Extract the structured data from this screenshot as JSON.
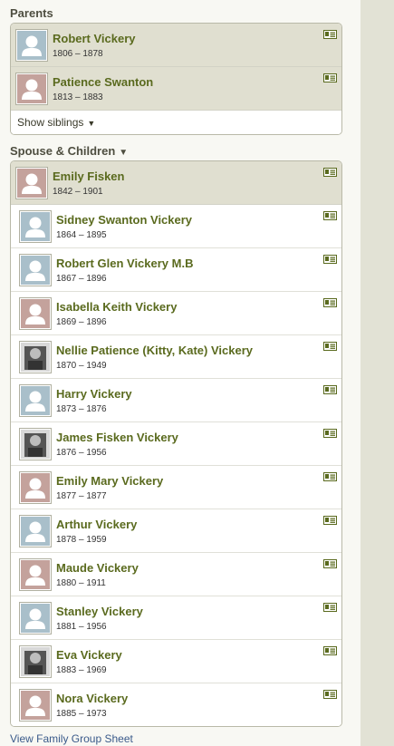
{
  "parents": {
    "title": "Parents",
    "people": [
      {
        "name": "Robert Vickery",
        "dates": "1806 – 1878",
        "gender": "male"
      },
      {
        "name": "Patience Swanton",
        "dates": "1813 – 1883",
        "gender": "female"
      }
    ],
    "show_siblings": "Show siblings"
  },
  "spouse_section": {
    "title": "Spouse & Children",
    "spouse": {
      "name": "Emily Fisken",
      "dates": "1842 – 1901",
      "gender": "female"
    },
    "children": [
      {
        "name": "Sidney Swanton Vickery",
        "dates": "1864 – 1895",
        "gender": "male"
      },
      {
        "name": "Robert Glen Vickery M.B",
        "dates": "1867 – 1896",
        "gender": "male"
      },
      {
        "name": "Isabella Keith Vickery",
        "dates": "1869 – 1896",
        "gender": "female"
      },
      {
        "name": "Nellie Patience (Kitty, Kate) Vickery",
        "dates": "1870 – 1949",
        "gender": "photo"
      },
      {
        "name": "Harry Vickery",
        "dates": "1873 – 1876",
        "gender": "male"
      },
      {
        "name": "James Fisken Vickery",
        "dates": "1876 – 1956",
        "gender": "photo"
      },
      {
        "name": "Emily Mary Vickery",
        "dates": "1877 – 1877",
        "gender": "female"
      },
      {
        "name": "Arthur Vickery",
        "dates": "1878 – 1959",
        "gender": "male"
      },
      {
        "name": "Maude Vickery",
        "dates": "1880 – 1911",
        "gender": "female"
      },
      {
        "name": "Stanley Vickery",
        "dates": "1881 – 1956",
        "gender": "male"
      },
      {
        "name": "Eva Vickery",
        "dates": "1883 – 1969",
        "gender": "photo"
      },
      {
        "name": "Nora Vickery",
        "dates": "1885 – 1973",
        "gender": "female"
      }
    ]
  },
  "footer": {
    "family_group_sheet": "View Family Group Sheet"
  },
  "colors": {
    "name_text": "#5a6a1e",
    "male_photo": "#a9bfca",
    "female_photo": "#c4a29c",
    "card_icon": "#5a6a1e",
    "tinted_row": "#e0dfd0"
  },
  "icons": {
    "profile_card": "card-icon",
    "expand": "triangle-down-icon",
    "placeholder_photo": "person-silhouette-icon"
  }
}
